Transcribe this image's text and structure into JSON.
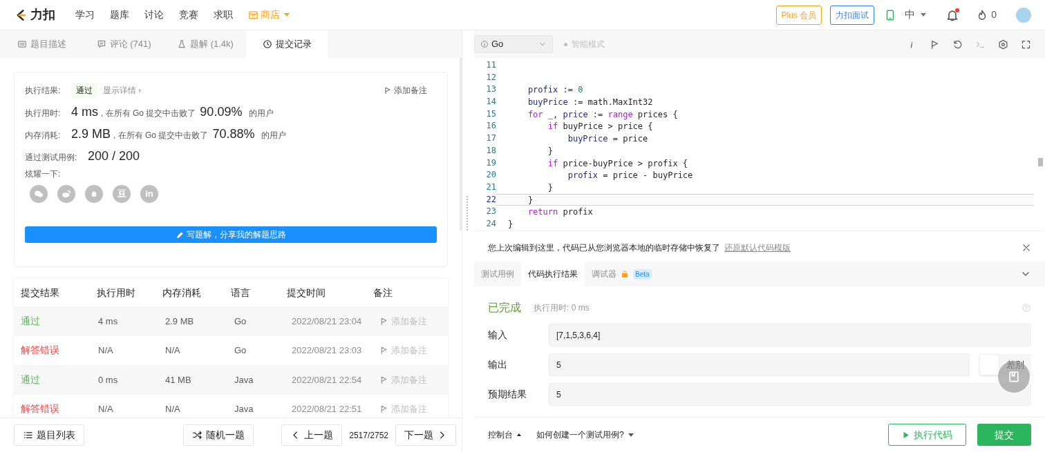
{
  "nav": {
    "logo": "力扣",
    "items": [
      {
        "label": "学习",
        "kind": "plain"
      },
      {
        "label": "题库",
        "kind": "plain"
      },
      {
        "label": "讨论",
        "kind": "plain"
      },
      {
        "label": "竞赛",
        "kind": "plain"
      },
      {
        "label": "求职",
        "kind": "plain"
      },
      {
        "label": "商店",
        "kind": "store"
      }
    ],
    "plus": "Plus 会员",
    "interview": "力扣面试",
    "lang": "中",
    "notifications_unread": true,
    "points": "0"
  },
  "left_tabs": [
    {
      "label": "题目描述",
      "selected": false
    },
    {
      "label": "评论 (741)",
      "selected": false
    },
    {
      "label": "题解 (1.4k)",
      "selected": false
    },
    {
      "label": "提交记录",
      "selected": true
    }
  ],
  "result": {
    "label": "执行结果:",
    "status": "通过",
    "details": "显示详情 ›",
    "note": "添加备注",
    "stats": [
      {
        "label": "执行用时:",
        "value": "4 ms",
        "text": ", 在所有 Go 提交中击败了",
        "percent": "90.09%",
        "suffix": "的用户"
      },
      {
        "label": "内存消耗:",
        "value": "2.9 MB",
        "text": ", 在所有 Go 提交中击败了",
        "percent": "70.88%",
        "suffix": "的用户"
      }
    ],
    "tests_label": "通过测试用例:",
    "tests": "200 / 200",
    "share_label": "炫耀一下:",
    "share": [
      {
        "kind": "wechat"
      },
      {
        "kind": "weibo"
      },
      {
        "kind": "qq"
      },
      {
        "kind": "glyph",
        "glyph": "豆"
      },
      {
        "kind": "glyph",
        "glyph": "in"
      }
    ],
    "write_button": "写题解，分享我的解题思路"
  },
  "submissions": {
    "columns": [
      "提交结果",
      "执行用时",
      "内存消耗",
      "语言",
      "提交时间",
      "备注"
    ],
    "rows": [
      {
        "status": "通过",
        "kind": "pass",
        "time": "4 ms",
        "memory": "2.9 MB",
        "language": "Go",
        "submitted": "2022/08/21 23:04",
        "note": "添加备注"
      },
      {
        "status": "解答错误",
        "kind": "fail",
        "time": "N/A",
        "memory": "N/A",
        "language": "Go",
        "submitted": "2022/08/21 23:03",
        "note": "添加备注"
      },
      {
        "status": "通过",
        "kind": "pass",
        "time": "0 ms",
        "memory": "41 MB",
        "language": "Java",
        "submitted": "2022/08/21 22:54",
        "note": "添加备注"
      },
      {
        "status": "解答错误",
        "kind": "fail",
        "time": "N/A",
        "memory": "N/A",
        "language": "Java",
        "submitted": "2022/08/21 22:51",
        "note": "添加备注"
      }
    ]
  },
  "bottom_left": {
    "list": "题目列表",
    "random": "随机一题",
    "prev": "上一题",
    "progress": "2517/2752",
    "next": "下一题"
  },
  "editor": {
    "language": "Go",
    "smart_mode": "智能模式",
    "lines": [
      {
        "number": "11",
        "current": false
      },
      {
        "number": "12",
        "current": false
      },
      {
        "number": "13",
        "current": false,
        "tokens": [
          {
            "kind": "var",
            "text": "    profix"
          },
          {
            "kind": "plain",
            "text": " := "
          },
          {
            "kind": "num",
            "text": "0"
          }
        ]
      },
      {
        "number": "14",
        "current": false,
        "tokens": [
          {
            "kind": "var",
            "text": "    buyPrice"
          },
          {
            "kind": "plain",
            "text": " := math.MaxInt32"
          }
        ]
      },
      {
        "number": "15",
        "current": false,
        "tokens": [
          {
            "kind": "kw",
            "text": "    for"
          },
          {
            "kind": "plain",
            "text": " _, "
          },
          {
            "kind": "var",
            "text": "price"
          },
          {
            "kind": "plain",
            "text": " := "
          },
          {
            "kind": "kw",
            "text": "range"
          },
          {
            "kind": "plain",
            "text": " prices {"
          }
        ]
      },
      {
        "number": "16",
        "current": false,
        "tokens": [
          {
            "kind": "kw",
            "text": "        if"
          },
          {
            "kind": "plain",
            "text": " buyPrice > price {"
          }
        ]
      },
      {
        "number": "17",
        "current": false,
        "tokens": [
          {
            "kind": "var",
            "text": "            buyPrice"
          },
          {
            "kind": "plain",
            "text": " = price"
          }
        ]
      },
      {
        "number": "18",
        "current": false,
        "tokens": [
          {
            "kind": "plain",
            "text": "        }"
          }
        ]
      },
      {
        "number": "19",
        "current": false,
        "tokens": [
          {
            "kind": "kw",
            "text": "        if"
          },
          {
            "kind": "plain",
            "text": " price-buyPrice > profix {"
          }
        ]
      },
      {
        "number": "20",
        "current": false,
        "tokens": [
          {
            "kind": "var",
            "text": "            profix"
          },
          {
            "kind": "plain",
            "text": " = price - buyPrice"
          }
        ]
      },
      {
        "number": "21",
        "current": false,
        "tokens": [
          {
            "kind": "plain",
            "text": "        }"
          }
        ]
      },
      {
        "number": "22",
        "current": true,
        "tokens": [
          {
            "kind": "plain",
            "text": "    }"
          }
        ]
      },
      {
        "number": "23",
        "current": false,
        "tokens": [
          {
            "kind": "kw",
            "text": "    return"
          },
          {
            "kind": "plain",
            "text": " profix"
          }
        ]
      },
      {
        "number": "24",
        "current": false,
        "tokens": [
          {
            "kind": "plain",
            "text": "}"
          }
        ]
      }
    ]
  },
  "notice": {
    "text": "您上次编辑到这里，代码已从您浏览器本地的临时存储中恢复了",
    "link": "还原默认代码模版"
  },
  "console_tabs": [
    {
      "label": "测试用例",
      "selected": false
    },
    {
      "label": "代码执行结果",
      "selected": true
    },
    {
      "label": "调试器",
      "selected": false,
      "locked": true,
      "badge": "Beta"
    }
  ],
  "run_result": {
    "status": "已完成",
    "runtime": "执行用时: 0 ms",
    "fields": [
      {
        "label": "输入",
        "value": "[7,1,5,3,6,4]",
        "kind": "plain"
      },
      {
        "label": "输出",
        "value": "5",
        "kind": "diff",
        "diff_label": "差别"
      },
      {
        "label": "预期结果",
        "value": "5",
        "kind": "plain"
      }
    ]
  },
  "bottom_right": {
    "console": "控制台",
    "howto": "如何创建一个测试用例?",
    "run": "执行代码",
    "submit": "提交"
  }
}
